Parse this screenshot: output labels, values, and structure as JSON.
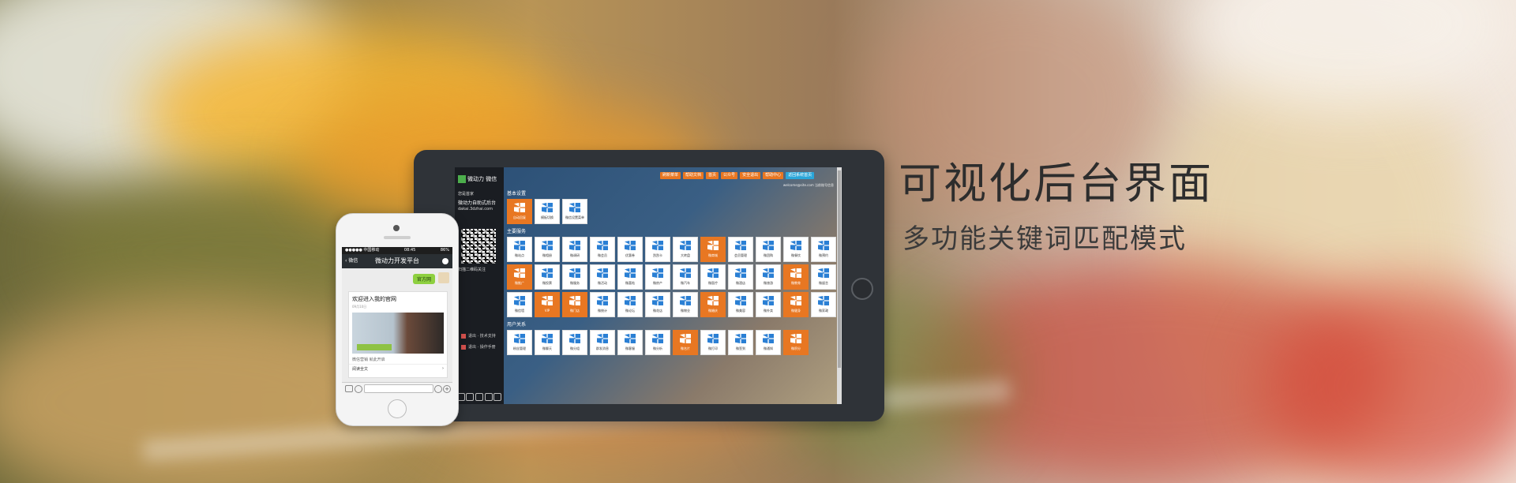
{
  "banner": {
    "headline": "可视化后台界面",
    "subheadline": "多功能关键词匹配模式"
  },
  "tablet": {
    "sidebar": {
      "logo_text": "微动力",
      "logo_sub": "微信",
      "welcome": "您是首家",
      "platform": "微动力自助式后台",
      "site": "dakai.3dzhai.com",
      "qr_note": "扫描二维码关注",
      "links": [
        "退出 · 技术支持",
        "退出 · 操作手册"
      ]
    },
    "topbar": [
      "刷新菜单",
      "帮助文档",
      "首页",
      "公众号",
      "安全退出",
      "帮助中心",
      "返回系统首页"
    ],
    "userinfo": "welcome@site.com  当前账号信息",
    "sections": [
      {
        "title": "基本设置",
        "tiles": [
          {
            "label": "自动回复",
            "orange": true
          },
          {
            "label": "模板切换",
            "orange": false
          },
          {
            "label": "微信设置菜单",
            "orange": false
          }
        ]
      },
      {
        "title": "主要服务",
        "tiles": [
          {
            "label": "微站点",
            "orange": false
          },
          {
            "label": "微相册",
            "orange": false
          },
          {
            "label": "微调研",
            "orange": false
          },
          {
            "label": "微会员",
            "orange": false
          },
          {
            "label": "优惠券",
            "orange": false
          },
          {
            "label": "刮刮卡",
            "orange": false
          },
          {
            "label": "大转盘",
            "orange": false
          },
          {
            "label": "微商城",
            "orange": true
          },
          {
            "label": "会员管理",
            "orange": false
          },
          {
            "label": "微团购",
            "orange": false
          },
          {
            "label": "微餐饮",
            "orange": false
          },
          {
            "label": "微预约",
            "orange": false
          },
          {
            "label": "微推广",
            "orange": true
          },
          {
            "label": "微投票",
            "orange": false
          },
          {
            "label": "微服务",
            "orange": false
          },
          {
            "label": "微活动",
            "orange": false
          },
          {
            "label": "微喜帖",
            "orange": false
          },
          {
            "label": "微房产",
            "orange": false
          },
          {
            "label": "微汽车",
            "orange": false
          },
          {
            "label": "微医疗",
            "orange": false
          },
          {
            "label": "微酒店",
            "orange": false
          },
          {
            "label": "微旅游",
            "orange": false
          },
          {
            "label": "微教育",
            "orange": true
          },
          {
            "label": "微留言",
            "orange": false
          },
          {
            "label": "微信墙",
            "orange": false
          },
          {
            "label": "VIP",
            "orange": true
          },
          {
            "label": "微门店",
            "orange": true
          },
          {
            "label": "微统计",
            "orange": false
          },
          {
            "label": "微论坛",
            "orange": false
          },
          {
            "label": "微花店",
            "orange": false
          },
          {
            "label": "微物业",
            "orange": false
          },
          {
            "label": "微婚庆",
            "orange": true
          },
          {
            "label": "微美容",
            "orange": false
          },
          {
            "label": "微外卖",
            "orange": false
          },
          {
            "label": "微健身",
            "orange": true
          },
          {
            "label": "微家政",
            "orange": false
          }
        ]
      },
      {
        "title": "用户关系",
        "tiles": [
          {
            "label": "粉丝管理",
            "orange": false
          },
          {
            "label": "微聊天",
            "orange": false
          },
          {
            "label": "微分组",
            "orange": false
          },
          {
            "label": "群发消息",
            "orange": false
          },
          {
            "label": "微客服",
            "orange": false
          },
          {
            "label": "微分析",
            "orange": false
          },
          {
            "label": "微名片",
            "orange": true
          },
          {
            "label": "微打印",
            "orange": false
          },
          {
            "label": "微签到",
            "orange": false
          },
          {
            "label": "微通知",
            "orange": false
          },
          {
            "label": "微积分",
            "orange": true
          }
        ]
      }
    ]
  },
  "phone": {
    "status_left": "●●●●● 中国移动",
    "status_time": "08:45",
    "status_right": "86%",
    "back_label": "微信",
    "nav_title": "微动力开发平台",
    "bubble": "官方网",
    "card_title": "欢迎进入我的官网",
    "card_date": "09月10日",
    "card_desc": "微信营销 就此开启",
    "card_more": "阅读全文"
  },
  "colors": {
    "accent_orange": "#e87722",
    "accent_blue": "#2aa6d9",
    "wechat_green": "#8ed040"
  }
}
